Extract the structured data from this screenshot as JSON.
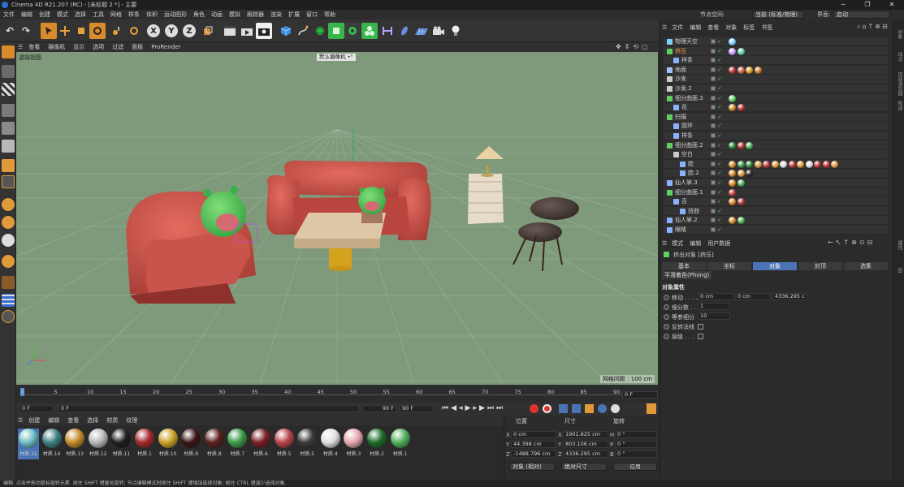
{
  "window": {
    "title": "Cinema 4D R21.207 (RC) - [未标题 2 *] - 主要",
    "minimize": "─",
    "maximize": "❐",
    "close": "✕"
  },
  "menubar": {
    "items": [
      "文件",
      "编辑",
      "创建",
      "模式",
      "选择",
      "工具",
      "网格",
      "样条",
      "体积",
      "运动图形",
      "角色",
      "动画",
      "模拟",
      "跟踪器",
      "渲染",
      "扩展",
      "窗口",
      "帮助"
    ],
    "node_space_label": "节点空间:",
    "node_space_value": "当前 (标准/物理)",
    "layout_label": "界面:",
    "layout_value": "启动"
  },
  "toolbar": {
    "undo": "↶",
    "redo": "↷",
    "x": "X",
    "y": "Y",
    "z": "Z"
  },
  "viewport_menu": {
    "items": [
      "查看",
      "摄像机",
      "显示",
      "选项",
      "过滤",
      "面板",
      "ProRender"
    ]
  },
  "viewport": {
    "name": "透视视图",
    "camera": "默认摄像机 •°",
    "grid_spacing": "网格间距 : 100 cm"
  },
  "timeline": {
    "ticks": [
      "0",
      "5",
      "10",
      "15",
      "20",
      "25",
      "30",
      "35",
      "40",
      "45",
      "50",
      "55",
      "60",
      "65",
      "70",
      "75",
      "80",
      "85",
      "90"
    ],
    "end_frame": "0 F"
  },
  "transport": {
    "current": "0 F",
    "start": "0 F",
    "end_field": "90 F",
    "end_field2": "90 F"
  },
  "materials": {
    "menu": [
      "创建",
      "编辑",
      "查看",
      "选择",
      "材质",
      "纹理"
    ],
    "items": [
      {
        "label": "材质.15",
        "color": "#6fc0c5"
      },
      {
        "label": "材质.14",
        "color": "#3f7f83"
      },
      {
        "label": "材质.13",
        "color": "#c58a2a"
      },
      {
        "label": "材质.12",
        "color": "#b8b8b8"
      },
      {
        "label": "材质.11",
        "color": "#1e1e1e"
      },
      {
        "label": "材质.1",
        "color": "#a3282c"
      },
      {
        "label": "材质.10",
        "color": "#caa22a"
      },
      {
        "label": "材质.9",
        "color": "#3a1414"
      },
      {
        "label": "材质.8",
        "color": "#5a1e1e"
      },
      {
        "label": "材质.7",
        "color": "#3a9a48"
      },
      {
        "label": "材质.6",
        "color": "#7a1f24"
      },
      {
        "label": "材质.5",
        "color": "#b8434a"
      },
      {
        "label": "材质.5",
        "color": "#3b3b3b"
      },
      {
        "label": "材质.4",
        "color": "#e0e0e0"
      },
      {
        "label": "材质.3",
        "color": "#e6a6ad"
      },
      {
        "label": "材质.2",
        "color": "#1f6d2a"
      },
      {
        "label": "材质.1",
        "color": "#4fb05a"
      }
    ]
  },
  "coords": {
    "headers": {
      "position": "位置",
      "size": "尺寸",
      "rotation": "旋转"
    },
    "rows": [
      {
        "axis": "X",
        "pos": "0 cm",
        "size_axis": "X",
        "size": "1901.825 cm",
        "rot_axis": "H",
        "rot": "0 °"
      },
      {
        "axis": "Y",
        "pos": "44.398 cm",
        "size_axis": "Y",
        "size": "803.106 cm",
        "rot_axis": "P",
        "rot": "0 °"
      },
      {
        "axis": "Z",
        "pos": "-1488.796 cm",
        "size_axis": "Z",
        "size": "4336.295 cm",
        "rot_axis": "B",
        "rot": "0 °"
      }
    ],
    "mode": "对象 (相对)",
    "size_mode": "绝对尺寸",
    "apply": "应用"
  },
  "status": "编辑: 点击并拖动鼠标旋转元素. 按住 SHIFT 键量化旋转; 节点编辑模式时按住 SHIFT 键增加选择对象; 按住 CTRL 键减少选择对象.",
  "objects_panel": {
    "menu": [
      "文件",
      "编辑",
      "查看",
      "对象",
      "标签",
      "书签"
    ],
    "rows": [
      {
        "name": "物理天空",
        "indent": 0,
        "icon": "#7fd0ff"
      },
      {
        "name": "挤压",
        "indent": 0,
        "icon": "#5fd05f",
        "selected": true
      },
      {
        "name": "样条",
        "indent": 1,
        "icon": "#8ab0ff"
      },
      {
        "name": "地面",
        "indent": 0,
        "icon": "#9fc4ff"
      },
      {
        "name": "沙发",
        "indent": 0,
        "icon": "#cccccc"
      },
      {
        "name": "沙发.2",
        "indent": 0,
        "icon": "#cccccc"
      },
      {
        "name": "细分曲面.3",
        "indent": 0,
        "icon": "#5fd05f"
      },
      {
        "name": "花",
        "indent": 1,
        "icon": "#8ab0ff"
      },
      {
        "name": "扫描",
        "indent": 0,
        "icon": "#5fd05f"
      },
      {
        "name": "圆环",
        "indent": 1,
        "icon": "#8ab0ff"
      },
      {
        "name": "样条",
        "indent": 1,
        "icon": "#8ab0ff"
      },
      {
        "name": "细分曲面.2",
        "indent": 0,
        "icon": "#5fd05f"
      },
      {
        "name": "空白",
        "indent": 1,
        "icon": "#cccccc"
      },
      {
        "name": "脸",
        "indent": 2,
        "icon": "#8ab0ff"
      },
      {
        "name": "脸.2",
        "indent": 2,
        "icon": "#8ab0ff"
      },
      {
        "name": "仙人掌.3",
        "indent": 0,
        "icon": "#8ab0ff"
      },
      {
        "name": "细分曲面.1",
        "indent": 0,
        "icon": "#5fd05f"
      },
      {
        "name": "舌",
        "indent": 1,
        "icon": "#8ab0ff"
      },
      {
        "name": "扭曲",
        "indent": 2,
        "icon": "#8ab0ff"
      },
      {
        "name": "仙人掌.2",
        "indent": 0,
        "icon": "#8ab0ff"
      },
      {
        "name": "眼睛",
        "indent": 0,
        "icon": "#8ab0ff"
      }
    ]
  },
  "attributes": {
    "menu": [
      "模式",
      "编辑",
      "用户数据"
    ],
    "object_title": "挤出对象 [挤压]",
    "tabs": [
      "基本",
      "坐标",
      "对象",
      "封顶",
      "选集"
    ],
    "active_tab": "对象",
    "shading_tag": "平滑着色(Phong)",
    "section": "对象属性",
    "props": {
      "move_label": "移动 . . . .",
      "move_x": "0 cm",
      "move_y": "0 cm",
      "move_z": "4336.295 c",
      "subdiv_label": "细分数 . .",
      "subdiv": "1",
      "iso_label": "等参细分",
      "iso": "10",
      "flip_label": "反转法线",
      "hier_label": "层级 . . ."
    }
  },
  "side_tabs": [
    "对象",
    "场次",
    "内容浏览器",
    "构造",
    "属性",
    "层"
  ]
}
